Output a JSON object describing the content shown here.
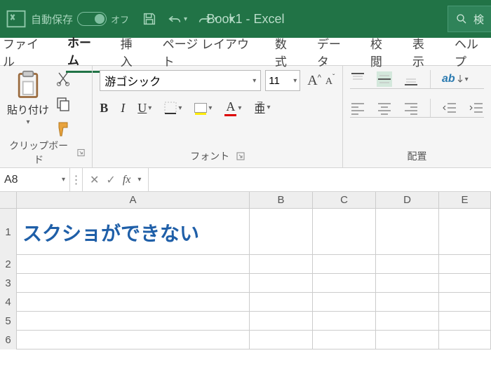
{
  "titlebar": {
    "autosave_label": "自動保存",
    "autosave_state": "オフ",
    "title": "Book1 - Excel",
    "search_placeholder": "検"
  },
  "tabs": {
    "file": "ファイル",
    "home": "ホーム",
    "insert": "挿入",
    "page_layout": "ページ レイアウト",
    "formulas": "数式",
    "data": "データ",
    "review": "校閲",
    "view": "表示",
    "help": "ヘルプ"
  },
  "ribbon": {
    "clipboard": {
      "paste": "貼り付け",
      "label": "クリップボード"
    },
    "font": {
      "name": "游ゴシック",
      "size": "11",
      "label": "フォント",
      "bold": "B",
      "italic": "I",
      "underline": "U",
      "grow": "A",
      "shrink": "A",
      "font_color": "A",
      "ruby_top": "ア",
      "ruby_bottom": "亜"
    },
    "align": {
      "label": "配置",
      "wrap": "ab"
    }
  },
  "formula_bar": {
    "name_box": "A8",
    "fx": "fx"
  },
  "grid": {
    "cols": [
      "A",
      "B",
      "C",
      "D",
      "E"
    ],
    "rows": [
      "1",
      "2",
      "3",
      "4",
      "5",
      "6"
    ],
    "cell_A1": "スクショができない"
  }
}
